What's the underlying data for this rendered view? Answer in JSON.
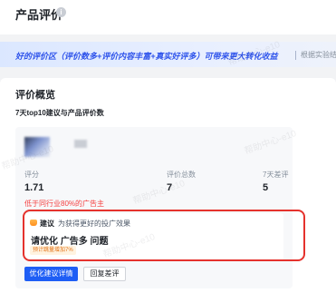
{
  "header": {
    "title": "产品评价",
    "info_icon": "info-icon"
  },
  "banner": {
    "text": "好的评价区（评价数多+评价内容丰富+真实好评多）可带来更大转化收益",
    "hint": "根据实验结",
    "accent": "#2f54eb"
  },
  "overview": {
    "title": "评价概览",
    "subtitle": "7天top10建议与产品评价数"
  },
  "metrics": [
    {
      "label": "评分",
      "value": "1.71"
    },
    {
      "label": "评价总数",
      "value": "7"
    },
    {
      "label": "7天差评",
      "value": "5"
    }
  ],
  "metric_note": "低于同行业80%的广告主",
  "suggestion": {
    "tag": "建议",
    "description": "为获得更好的投广效果",
    "title": "请优化 广告多 问题",
    "badge": "预计跳量增加7%",
    "icon": "bulb-icon"
  },
  "buttons": {
    "primary": "优化建议详情",
    "secondary": "回复差评"
  },
  "watermark": "帮助中心-e10",
  "colors": {
    "primary": "#1e5ef5",
    "warning": "#f53f3f",
    "highlight": "#e5322d"
  }
}
